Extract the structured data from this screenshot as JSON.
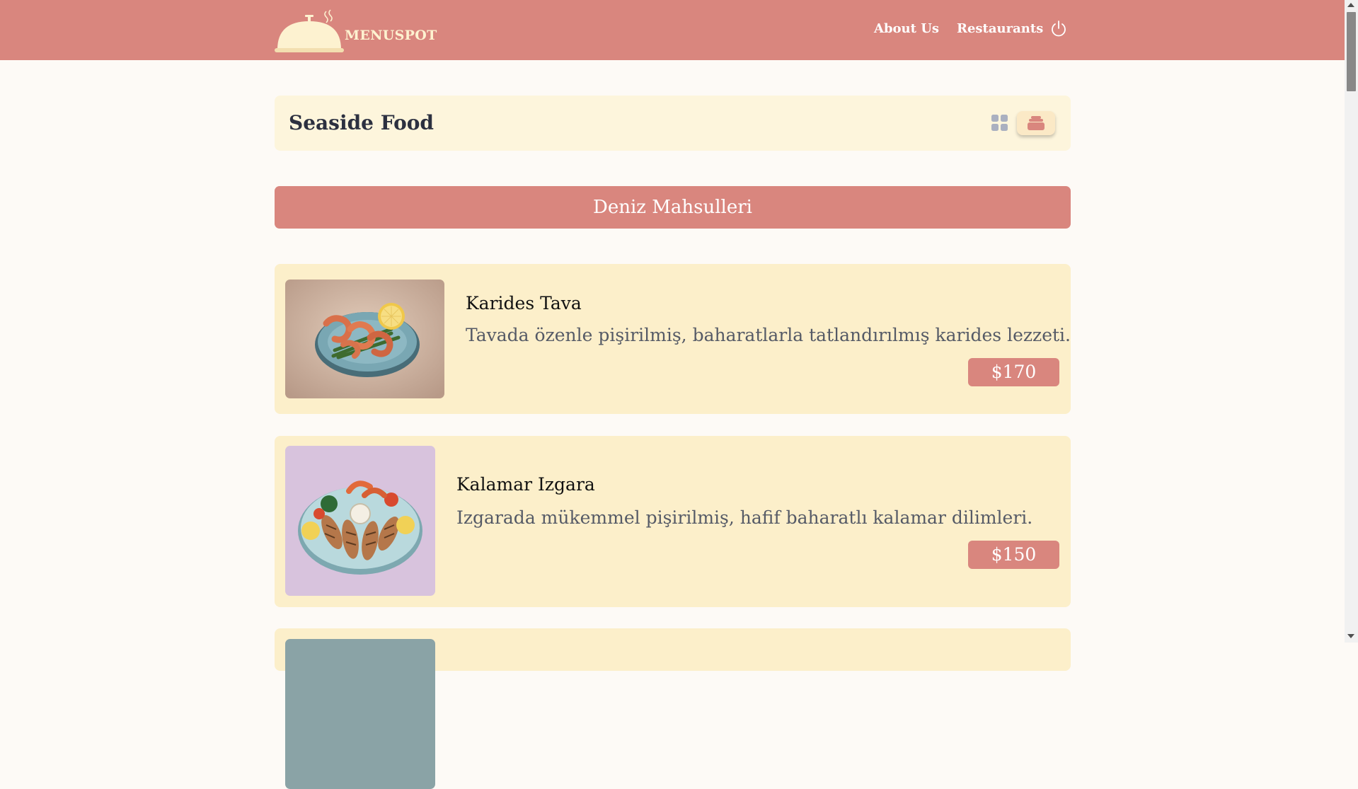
{
  "header": {
    "brand": "MENUSPOT",
    "nav": [
      {
        "label": "About Us"
      },
      {
        "label": "Restaurants"
      }
    ]
  },
  "restaurant": {
    "name": "Seaside Food"
  },
  "category": {
    "label": "Deniz Mahsulleri"
  },
  "items": [
    {
      "name": "Karides Tava",
      "description": "Tavada özenle pişirilmiş, baharatlarla tatlandırılmış karides lezzeti.",
      "price": "$170"
    },
    {
      "name": "Kalamar Izgara",
      "description": "Izgarada mükemmel pişirilmiş, hafif baharatlı kalamar dilimleri.",
      "price": "$150"
    }
  ],
  "colors": {
    "header_bg": "#d9867e",
    "accent": "#d9867e",
    "card_bg": "#fcefca",
    "page_bg": "#fdfaf6"
  }
}
